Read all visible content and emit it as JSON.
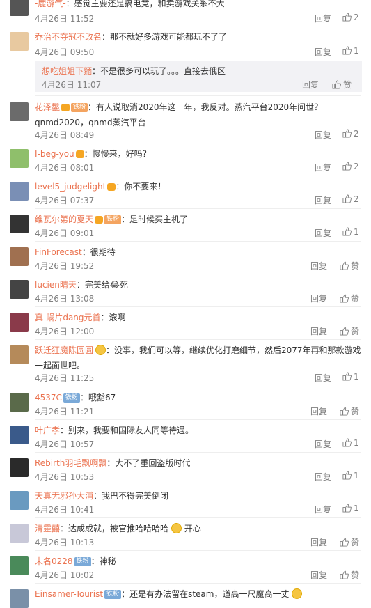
{
  "labels": {
    "reply": "回复",
    "like": "赞"
  },
  "comments": [
    {
      "name": "-鹿游气-",
      "text": "：感觉主要还是搞电竞，和卖游戏关系不大",
      "time": "4月26日 11:52",
      "likes": "2"
    },
    {
      "name": "乔治不夺冠不改名",
      "text": "：那不就好多游戏可能都玩不了了",
      "time": "4月26日 09:50",
      "likes": "1"
    },
    {
      "name": "想吃姐姐下麵",
      "text": "：不是很多可以玩了。。。直接去俄区",
      "time": "4月26日 11:07",
      "likes": "赞"
    },
    {
      "name": "花泽鬣",
      "text": "：有人说取消2020年这一年，我反对。蒸汽平台2020年问世？",
      "text2": "qnmd2020，qnmd蒸汽平台",
      "time": "4月26日 08:49",
      "likes": "2"
    },
    {
      "name": "I-beg-you",
      "text": "：慢慢来，好吗？",
      "time": "4月26日 08:01",
      "likes": "2"
    },
    {
      "name": "level5_judgelight",
      "text": "：你不要来！",
      "time": "4月26日 07:37",
      "likes": "2"
    },
    {
      "name": "维瓦尔第的夏天",
      "text": "：是时候买主机了",
      "time": "4月26日 09:01",
      "likes": "1"
    },
    {
      "name": "FinForecast",
      "text": "：很期待",
      "time": "4月26日 19:52",
      "likes": "赞"
    },
    {
      "name": "lucien晴天",
      "text": "：完美给😂死",
      "time": "4月26日 13:08",
      "likes": "赞"
    },
    {
      "name": "真-蜗片dang元首",
      "text": "：滚啊",
      "time": "4月26日 12:00",
      "likes": "赞"
    },
    {
      "name": "跃迁狂魔陈圆圆",
      "text": "：没事，我们可以等，继续优化打磨细节，然后2077年再和那款游戏",
      "text2": "一起面世吧。",
      "time": "4月26日 11:25",
      "likes": "1"
    },
    {
      "name": "4537C",
      "text": "：哦豁67",
      "time": "4月26日 11:21",
      "likes": "赞"
    },
    {
      "name": "叶广孝",
      "text": "：别来，我要和国际友人同等待遇。",
      "time": "4月26日 10:57",
      "likes": "1"
    },
    {
      "name": "Rebirth羽毛飘啊飘",
      "text": "：大不了重回盗版时代",
      "time": "4月26日 10:53",
      "likes": "1"
    },
    {
      "name": "天真无邪孙大浦",
      "text": "：我巴不得完美倒闭",
      "time": "4月26日 10:41",
      "likes": "1"
    },
    {
      "name": "清靈囍",
      "text": "：达成成就，被官推哈哈哈哈",
      "text2": "开心",
      "time": "4月26日 10:13",
      "likes": "赞"
    },
    {
      "name": "未名0228",
      "text": "：神秘",
      "time": "4月26日 10:02",
      "likes": "赞"
    },
    {
      "name": "Einsamer-Tourist",
      "text": "：还是有办法留在steam，道高一尺魔高一丈",
      "time": "",
      "likes": ""
    }
  ],
  "badges": {
    "fan": "铁粉"
  }
}
